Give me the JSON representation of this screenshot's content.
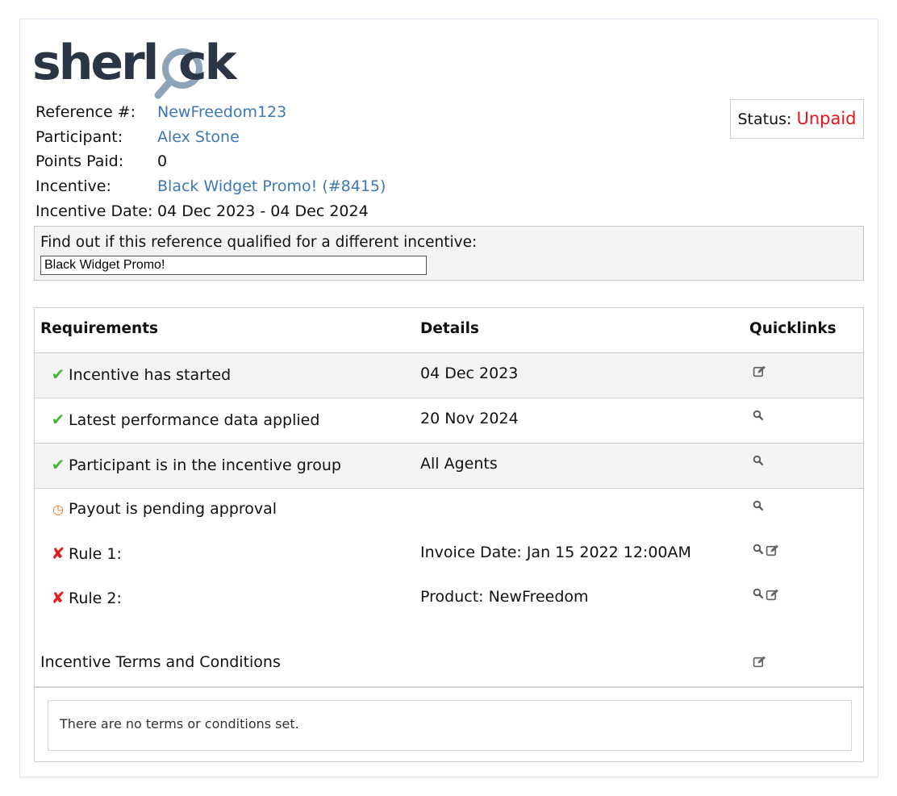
{
  "logo": {
    "text_before": "sherl",
    "text_after": "ck",
    "icon": "magnifier-icon"
  },
  "reference": {
    "label": "Reference #:",
    "value": "NewFreedom123"
  },
  "participant": {
    "label": "Participant:",
    "value": "Alex Stone"
  },
  "points_paid": {
    "label": "Points Paid:",
    "value": "0"
  },
  "incentive": {
    "label": "Incentive:",
    "value": "Black Widget Promo! (#8415)"
  },
  "incentive_date": {
    "label": "Incentive Date:",
    "value": "04 Dec 2023 - 04 Dec 2024"
  },
  "status": {
    "label": "Status:",
    "value": "Unpaid",
    "value_color": "#e8141e"
  },
  "finder": {
    "label": "Find out if this reference qualified for a different incentive:",
    "input_value": "Black Widget Promo!"
  },
  "table": {
    "headers": {
      "requirements": "Requirements",
      "details": "Details",
      "quicklinks": "Quicklinks"
    },
    "rows": [
      {
        "status": "check",
        "requirement": "Incentive has started",
        "details": "04 Dec 2023",
        "quicklinks": [
          "edit-icon"
        ]
      },
      {
        "status": "check",
        "requirement": "Latest performance data applied",
        "details": "20 Nov 2024",
        "quicklinks": [
          "search-icon"
        ]
      },
      {
        "status": "check",
        "requirement": "Participant is in the incentive group",
        "details": "All Agents",
        "quicklinks": [
          "search-icon"
        ]
      },
      {
        "status": "clock",
        "requirement": "Payout is pending approval",
        "details": "",
        "quicklinks": [
          "search-icon"
        ]
      },
      {
        "status": "cross",
        "requirement": "Rule 1:",
        "details": "Invoice Date: Jan 15 2022 12:00AM",
        "quicklinks": [
          "search-icon",
          "edit-icon"
        ]
      },
      {
        "status": "cross",
        "requirement": "Rule 2:",
        "details": "Product: NewFreedom",
        "quicklinks": [
          "search-icon",
          "edit-icon"
        ]
      }
    ],
    "terms": {
      "label": "Incentive Terms and Conditions",
      "quicklinks": [
        "edit-icon"
      ],
      "message": "There are no terms or conditions set."
    }
  },
  "colors": {
    "link": "#3c78b4",
    "check": "#4ab63a",
    "cross": "#e01e1e",
    "clock": "#e07a1e",
    "logo_text": "#2a3546",
    "logo_lens": "#8ea4b8"
  }
}
